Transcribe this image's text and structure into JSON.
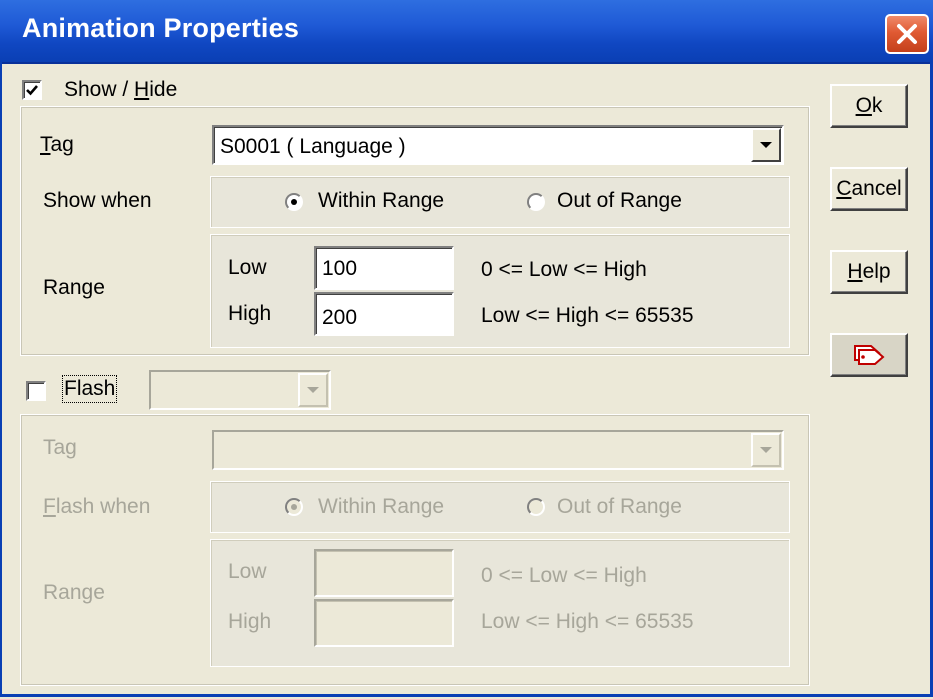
{
  "window": {
    "title": "Animation Properties"
  },
  "show_hide": {
    "checkbox_label_prefix": "Show / ",
    "checkbox_label_mnemonic": "H",
    "checkbox_label_suffix": "ide",
    "checked": true,
    "tag_label_mnemonic": "T",
    "tag_label_rest": "ag",
    "tag_value": "S0001 ( Language )",
    "show_when_label": "Show when",
    "within_range_label": "Within Range",
    "out_of_range_label": "Out of Range",
    "selected_option": "Within Range",
    "range_label": "Range",
    "low_label": "Low",
    "high_label": "High",
    "low_value": "100",
    "high_value": "200",
    "low_hint": "0 <= Low <= High",
    "high_hint": "Low <= High <= 65535"
  },
  "flash": {
    "checkbox_label": "Flash",
    "checked": false,
    "speed_value": "",
    "tag_label": "Tag",
    "tag_value": "",
    "flash_when_label_mnemonic": "F",
    "flash_when_label_rest": "lash when",
    "within_range_label": "Within Range",
    "out_of_range_label": "Out of Range",
    "selected_option": "Within Range",
    "range_label": "Range",
    "low_label": "Low",
    "high_label": "High",
    "low_value": "",
    "high_value": "",
    "low_hint": "0 <= Low <= High",
    "high_hint": "Low <= High <= 65535"
  },
  "buttons": {
    "ok_mnemonic": "O",
    "ok_rest": "k",
    "cancel_mnemonic": "C",
    "cancel_rest": "ancel",
    "help_mnemonic": "H",
    "help_rest": "elp",
    "tag_browser_icon": "tags-icon"
  },
  "colors": {
    "titlebar": "#0a3fb4",
    "dialog_bg": "#ece9d8",
    "disabled_text": "#a7a69a",
    "close_button": "#e05a33"
  }
}
